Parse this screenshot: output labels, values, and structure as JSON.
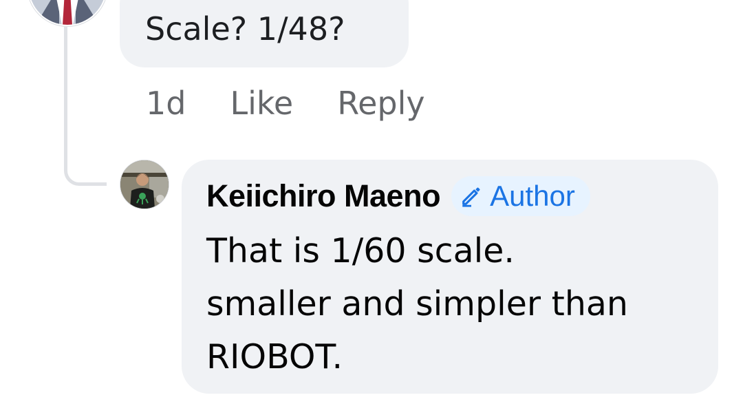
{
  "comment": {
    "text": "Scale? 1/48?",
    "actions": {
      "time": "1d",
      "like": "Like",
      "reply": "Reply"
    }
  },
  "reply": {
    "author": "Keiichiro Maeno",
    "badge": {
      "label": "Author",
      "icon": "pencil-icon"
    },
    "lines": [
      "That is 1/60 scale.",
      "smaller and simpler than",
      "RIOBOT."
    ]
  },
  "colors": {
    "bubble_bg": "#f0f2f5",
    "action_text": "#65676b",
    "badge_bg": "#e7f3ff",
    "badge_text": "#1b74e4",
    "thread_line": "#dfe1e5"
  }
}
